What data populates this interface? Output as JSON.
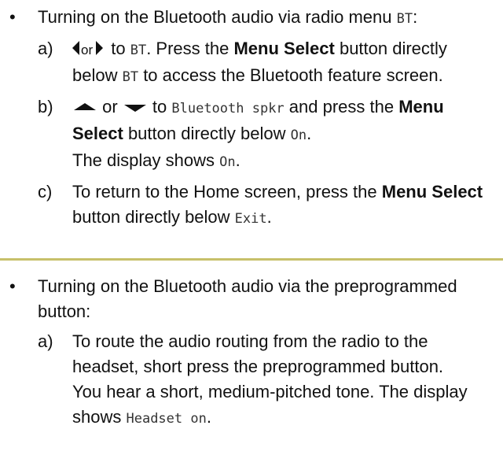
{
  "section1": {
    "bullet": "•",
    "intro": "Turning on the Bluetooth audio via radio menu ",
    "intro_code": "BT",
    "intro_end": ":",
    "steps": [
      {
        "label": "a)",
        "or": "or",
        "to": " to ",
        "code1": "BT",
        "text1": ". Press the ",
        "bold1": "Menu Select",
        "text2": " button directly below ",
        "code2": "BT",
        "text3": " to access the Bluetooth feature screen."
      },
      {
        "label": "b)",
        "or": " or ",
        "to": " to ",
        "code1": "Bluetooth spkr",
        "text1": " and press the ",
        "bold1": "Menu Select",
        "text2": " button directly below ",
        "code2": "On",
        "text3": ".",
        "line2a": "The display shows ",
        "line2code": "On",
        "line2b": "."
      },
      {
        "label": "c)",
        "text1": "To return to the Home screen, press the ",
        "bold1": "Menu Select",
        "text2": " button directly below ",
        "code1": "Exit",
        "text3": "."
      }
    ]
  },
  "section2": {
    "bullet": "•",
    "intro": "Turning on the Bluetooth audio via the preprogrammed button:",
    "steps": [
      {
        "label": "a)",
        "text1": "To route the audio routing from the radio to the headset, short press the preprogrammed button.",
        "line2a": "You hear a short, medium-pitched tone. The display shows ",
        "line2code": "Headset on",
        "line2b": "."
      }
    ]
  },
  "colors": {
    "divider": "#c7c06a",
    "text": "#111111"
  },
  "icons": [
    "left-arrow-icon",
    "right-arrow-icon",
    "up-arrow-icon",
    "down-arrow-icon"
  ]
}
